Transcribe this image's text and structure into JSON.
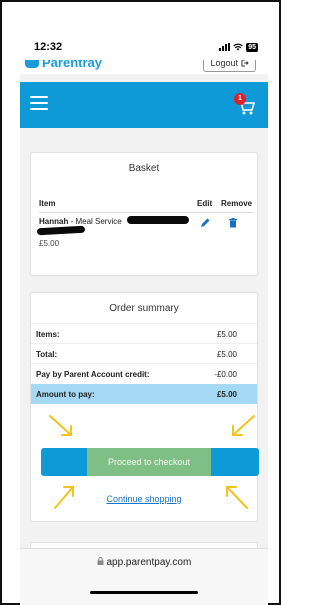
{
  "status_bar": {
    "time": "12:32",
    "battery": "95"
  },
  "header": {
    "brand": "Parentray",
    "logout_label": "Logout",
    "cart_count": "1"
  },
  "basket": {
    "title": "Basket",
    "columns": {
      "item": "Item",
      "edit": "Edit",
      "remove": "Remove"
    },
    "items": [
      {
        "child": "Hannah",
        "description": " - Meal Service",
        "price": "£5.00"
      }
    ]
  },
  "order_summary": {
    "title": "Order summary",
    "rows": [
      {
        "label": "Items:",
        "value": "£5.00"
      },
      {
        "label": "Total:",
        "value": "£5.00"
      },
      {
        "label": "Pay by Parent Account credit:",
        "value": "-£0.00"
      },
      {
        "label": "Amount to pay:",
        "value": "£5.00"
      }
    ],
    "checkout_label": "Proceed to checkout",
    "continue_label": "Continue shopping"
  },
  "browser": {
    "url": "app.parentpay.com"
  },
  "colors": {
    "brand_blue": "#0d9ad6",
    "highlight_row": "#a5d8f3",
    "annotation_arrow": "#f2c31c",
    "annotation_box": "#7fbf86"
  },
  "icons": [
    "hamburger-menu-icon",
    "cart-icon",
    "logout-icon",
    "pencil-icon",
    "trash-icon",
    "lock-icon",
    "signal-icon",
    "wifi-icon",
    "battery-icon"
  ]
}
